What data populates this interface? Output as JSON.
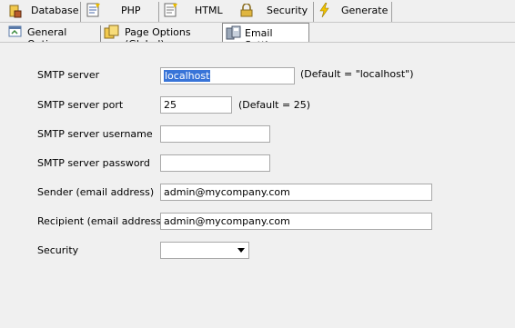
{
  "tabs": [
    {
      "label": "Database",
      "icon": "database-icon"
    },
    {
      "label": "PHP",
      "icon": "php-icon"
    },
    {
      "label": "HTML",
      "icon": "html-icon"
    },
    {
      "label": "Security",
      "icon": "lock-icon"
    },
    {
      "label": "Generate",
      "icon": "lightning-icon"
    }
  ],
  "subtabs": [
    {
      "label": "General Options",
      "icon": "general-options-icon"
    },
    {
      "label": "Page Options (Global)",
      "icon": "page-options-icon"
    },
    {
      "label": "Email Settings",
      "icon": "email-settings-icon"
    }
  ],
  "form": {
    "smtp_server": {
      "label": "SMTP server",
      "value": "localhost",
      "hint": "(Default = \"localhost\")"
    },
    "smtp_port": {
      "label": "SMTP server port",
      "value": "25",
      "hint": "(Default = 25)"
    },
    "smtp_username": {
      "label": "SMTP server username",
      "value": ""
    },
    "smtp_password": {
      "label": "SMTP server password",
      "value": ""
    },
    "sender": {
      "label": "Sender (email address)",
      "value": "admin@mycompany.com"
    },
    "recipient": {
      "label": "Recipient (email address)",
      "value": "admin@mycompany.com"
    },
    "security": {
      "label": "Security",
      "value": ""
    }
  },
  "colors": {
    "selection": "#3874d8",
    "panel_bg": "#f0f0f0"
  }
}
